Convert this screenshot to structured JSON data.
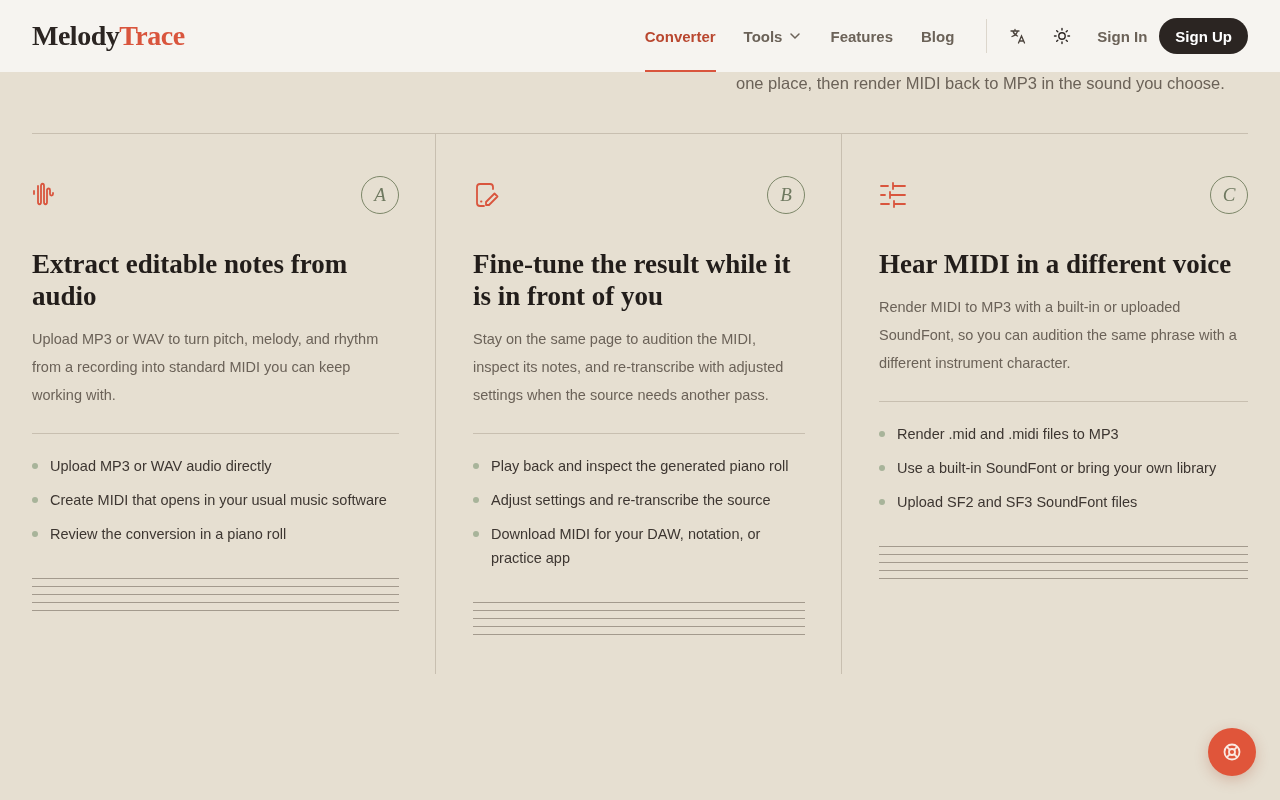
{
  "header": {
    "logo": {
      "first": "Melody",
      "second": "Trace"
    },
    "nav": [
      {
        "label": "Converter",
        "selected": true,
        "kind": "link"
      },
      {
        "label": "Tools",
        "selected": false,
        "kind": "dropdown"
      },
      {
        "label": "Features",
        "selected": false,
        "kind": "link"
      },
      {
        "label": "Blog",
        "selected": false,
        "kind": "link"
      }
    ],
    "sign_in": "Sign In",
    "sign_up": "Sign Up"
  },
  "intro_text": "one place, then render MIDI back to MP3 in the sound you choose.",
  "features": [
    {
      "letter": "A",
      "title": "Extract editable notes from audio",
      "description": "Upload MP3 or WAV to turn pitch, melody, and rhythm from a recording into standard MIDI you can keep working with.",
      "points": [
        "Upload MP3 or WAV audio directly",
        "Create MIDI that opens in your usual music software",
        "Review the conversion in a piano roll"
      ]
    },
    {
      "letter": "B",
      "title": "Fine-tune the result while it is in front of you",
      "description": "Stay on the same page to audition the MIDI, inspect its notes, and re-transcribe with adjusted settings when the source needs another pass.",
      "points": [
        "Play back and inspect the generated piano roll",
        "Adjust settings and re-transcribe the source",
        "Download MIDI for your DAW, notation, or practice app"
      ]
    },
    {
      "letter": "C",
      "title": "Hear MIDI in a different voice",
      "description": "Render MIDI to MP3 with a built-in or uploaded SoundFont, so you can audition the same phrase with a different instrument character.",
      "points": [
        "Render .mid and .midi files to MP3",
        "Use a built-in SoundFont or bring your own library",
        "Upload SF2 and SF3 SoundFont files"
      ]
    }
  ]
}
